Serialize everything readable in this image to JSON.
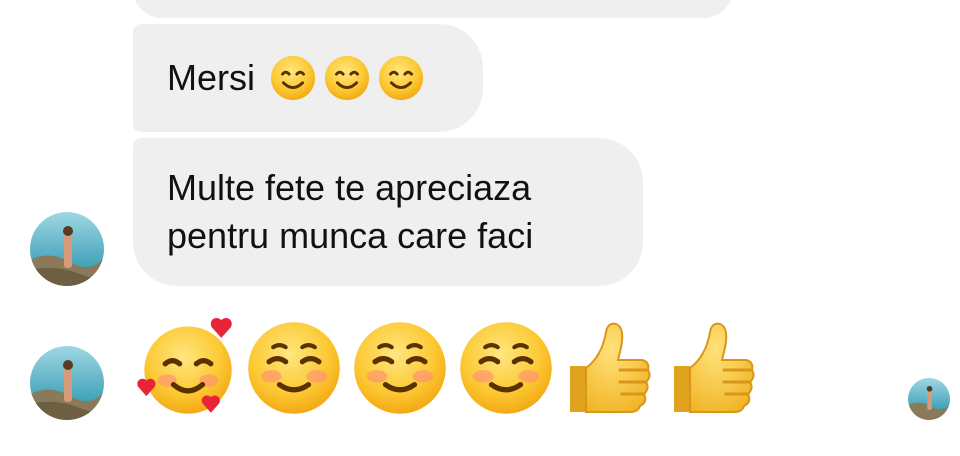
{
  "messages": [
    {
      "text": ""
    },
    {
      "text": "Mersi",
      "emojis": [
        "smiling-face-icon",
        "smiling-face-icon",
        "smiling-face-icon"
      ]
    },
    {
      "lines": [
        "Multe fete te apreciaza",
        "pentru munca care faci"
      ]
    }
  ],
  "reaction_emojis": [
    "smiling-face-with-hearts-icon",
    "smiling-face-icon",
    "smiling-face-icon",
    "smiling-face-icon",
    "thumbs-up-icon",
    "thumbs-up-icon"
  ],
  "colors": {
    "bubble": "#efeff0",
    "text": "#111111",
    "emoji_yellow": "#fbc02d"
  }
}
